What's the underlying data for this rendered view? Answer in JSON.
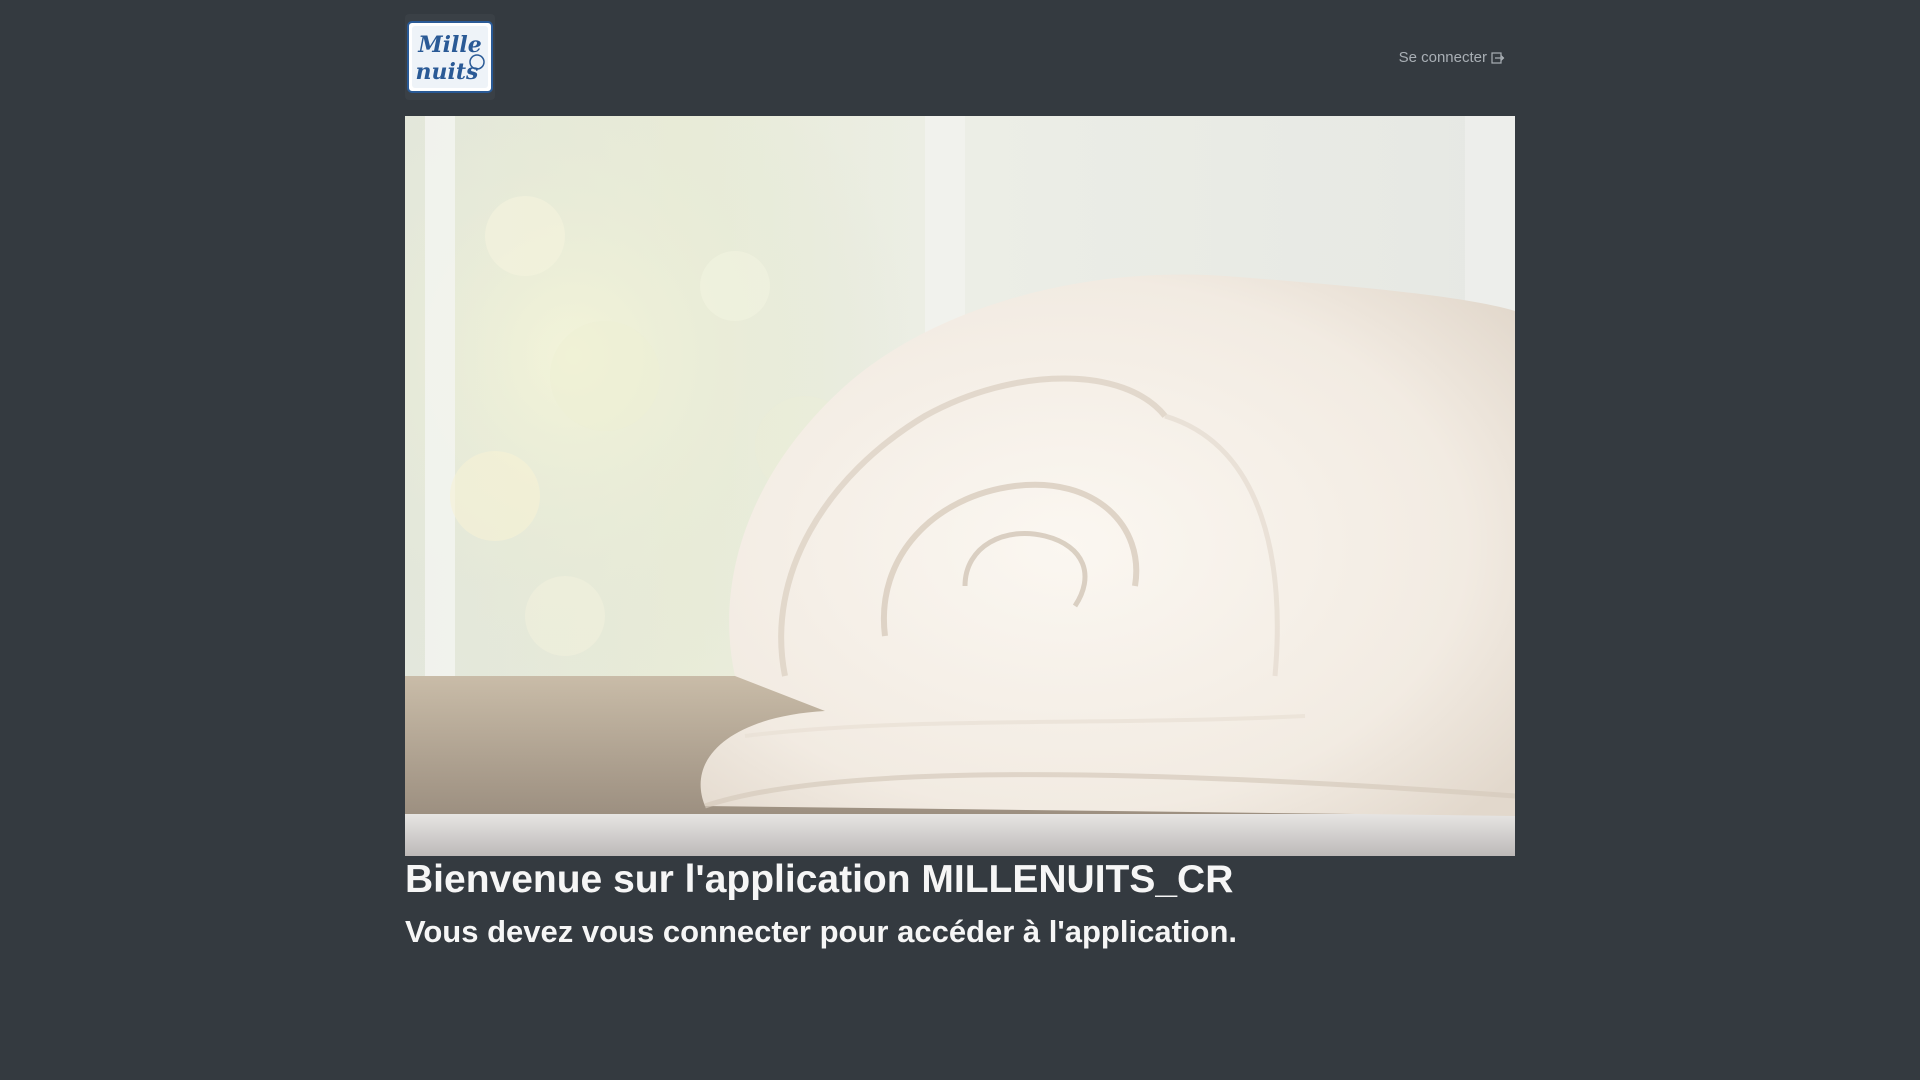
{
  "brand": {
    "logo_text_line1": "Mille",
    "logo_text_line2": "nuits",
    "logo_alt": "Mille nuits logo"
  },
  "nav": {
    "login_label": "Se connecter",
    "login_icon": "sign-in-icon"
  },
  "hero": {
    "image_subject": "rolled white duvet"
  },
  "main": {
    "welcome_title": "Bienvenue sur l'application MILLENUITS_CR",
    "login_prompt": "Vous devez vous connecter pour accéder à l'application."
  },
  "colors": {
    "background": "#343a40",
    "text": "#f6f6f6",
    "nav_link": "#a9afb5",
    "logo_blue": "#2a5a96"
  }
}
